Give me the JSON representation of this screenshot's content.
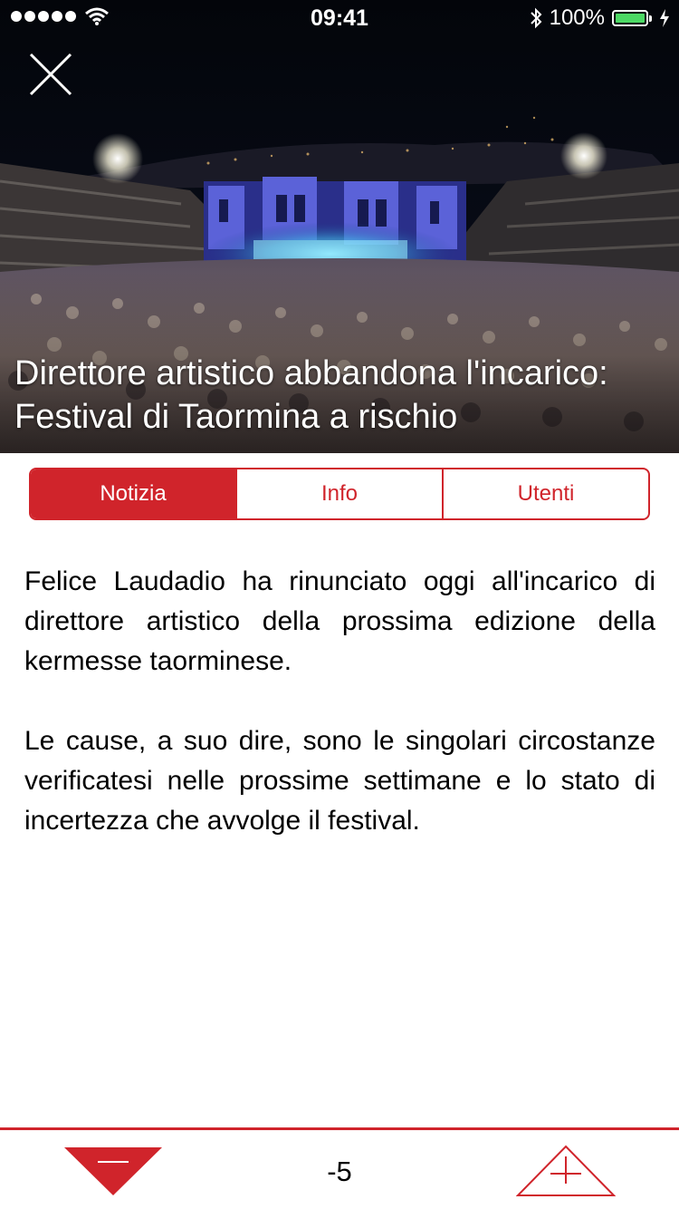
{
  "status_bar": {
    "time": "09:41",
    "battery_text": "100%",
    "icons": [
      "signal-dots",
      "wifi-icon",
      "bluetooth-icon",
      "battery-icon",
      "charging-bolt-icon"
    ]
  },
  "hero": {
    "title": "Direttore artistico abbandona l'incarico:\nFestival di Taormina a rischio",
    "image_subject": "Teatro Antico di Taormina at night with audience"
  },
  "tabs": [
    {
      "label": "Notizia",
      "active": true
    },
    {
      "label": "Info",
      "active": false
    },
    {
      "label": "Utenti",
      "active": false
    }
  ],
  "article": {
    "paragraphs": [
      "Felice Laudadio ha rinunciato oggi all'incarico di direttore artistico della prossima edizione della kermesse taorminese.",
      "Le cause, a suo dire, sono le singolari circostanze verificatesi nelle prossime settimane e lo stato di incertezza che avvolge il festival."
    ]
  },
  "vote_bar": {
    "score": "-5"
  },
  "colors": {
    "accent": "#d0242b",
    "battery": "#4cd964",
    "text": "#000000"
  }
}
